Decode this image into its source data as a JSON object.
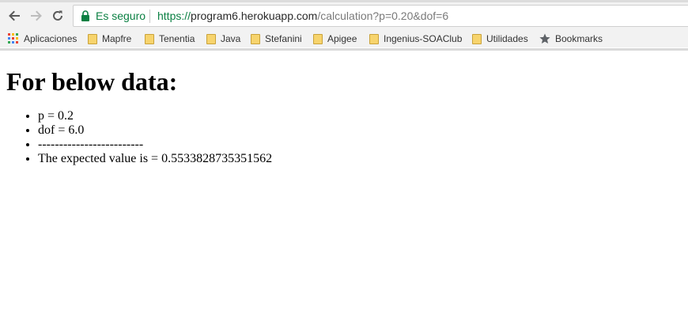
{
  "browser": {
    "secure_label": "Es seguro",
    "url_scheme": "https://",
    "url_host": "program6.herokuapp.com",
    "url_path": "/calculation?p=0.20&dof=6",
    "colors": {
      "secure": "#0b8043",
      "folder": "#f7d46d"
    },
    "icons": {
      "back": "back-arrow-icon",
      "forward": "forward-arrow-icon",
      "reload": "reload-icon",
      "lock": "lock-icon",
      "apps": "apps-grid-icon",
      "folder": "folder-icon",
      "star": "star-icon"
    }
  },
  "bookmarks": {
    "items": [
      {
        "label": "Aplicaciones"
      },
      {
        "label": "Mapfre"
      },
      {
        "label": "Tenentia"
      },
      {
        "label": "Java"
      },
      {
        "label": "Stefanini"
      },
      {
        "label": "Apigee"
      },
      {
        "label": "Ingenius-SOAClub"
      },
      {
        "label": "Utilidades"
      },
      {
        "label": "Bookmarks"
      }
    ]
  },
  "page": {
    "heading": "For below data:",
    "items": [
      "p = 0.2",
      "dof = 6.0",
      "-------------------------",
      "The expected value is = 0.5533828735351562"
    ]
  }
}
